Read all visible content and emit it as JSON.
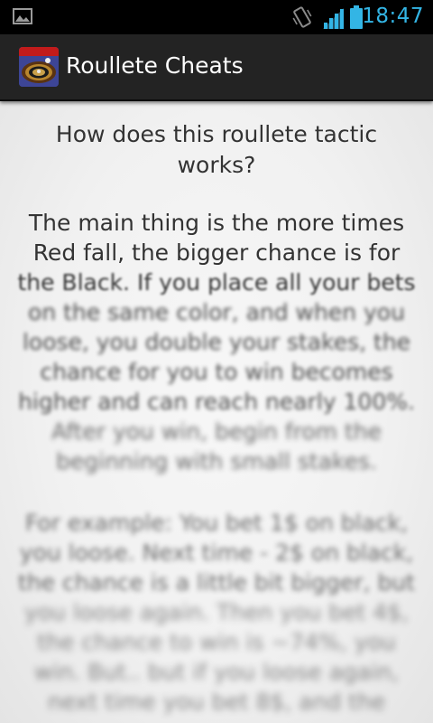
{
  "status_bar": {
    "time": "18:47",
    "icons": [
      "gallery-icon",
      "vibrate-icon",
      "signal-icon",
      "battery-icon"
    ],
    "accent_color": "#33b5e5"
  },
  "action_bar": {
    "title": "Roullete Cheats",
    "app_icon": "roulette-wheel-icon"
  },
  "content": {
    "question": "How does this roullete tactic works?",
    "paragraph1": [
      "The main thing is the more times",
      "Red fall, the bigger chance is for",
      "the Black. If you place all your bets",
      "on the same color, and when you",
      "loose, you double your stakes, the",
      "chance for you to win becomes",
      "higher and can reach nearly 100%.",
      "After you win, begin from the",
      "beginning with small stakes."
    ],
    "paragraph2": [
      "For example: You bet 1$ on black,",
      "you loose. Next time - 2$ on black,",
      "the chance is a little bit bigger, but",
      "you loose again. Then you bet 4$,",
      "the chance to win is ~74%, you",
      "win. But.. but if you loose again,",
      "next time you bet 8$, and the"
    ]
  }
}
